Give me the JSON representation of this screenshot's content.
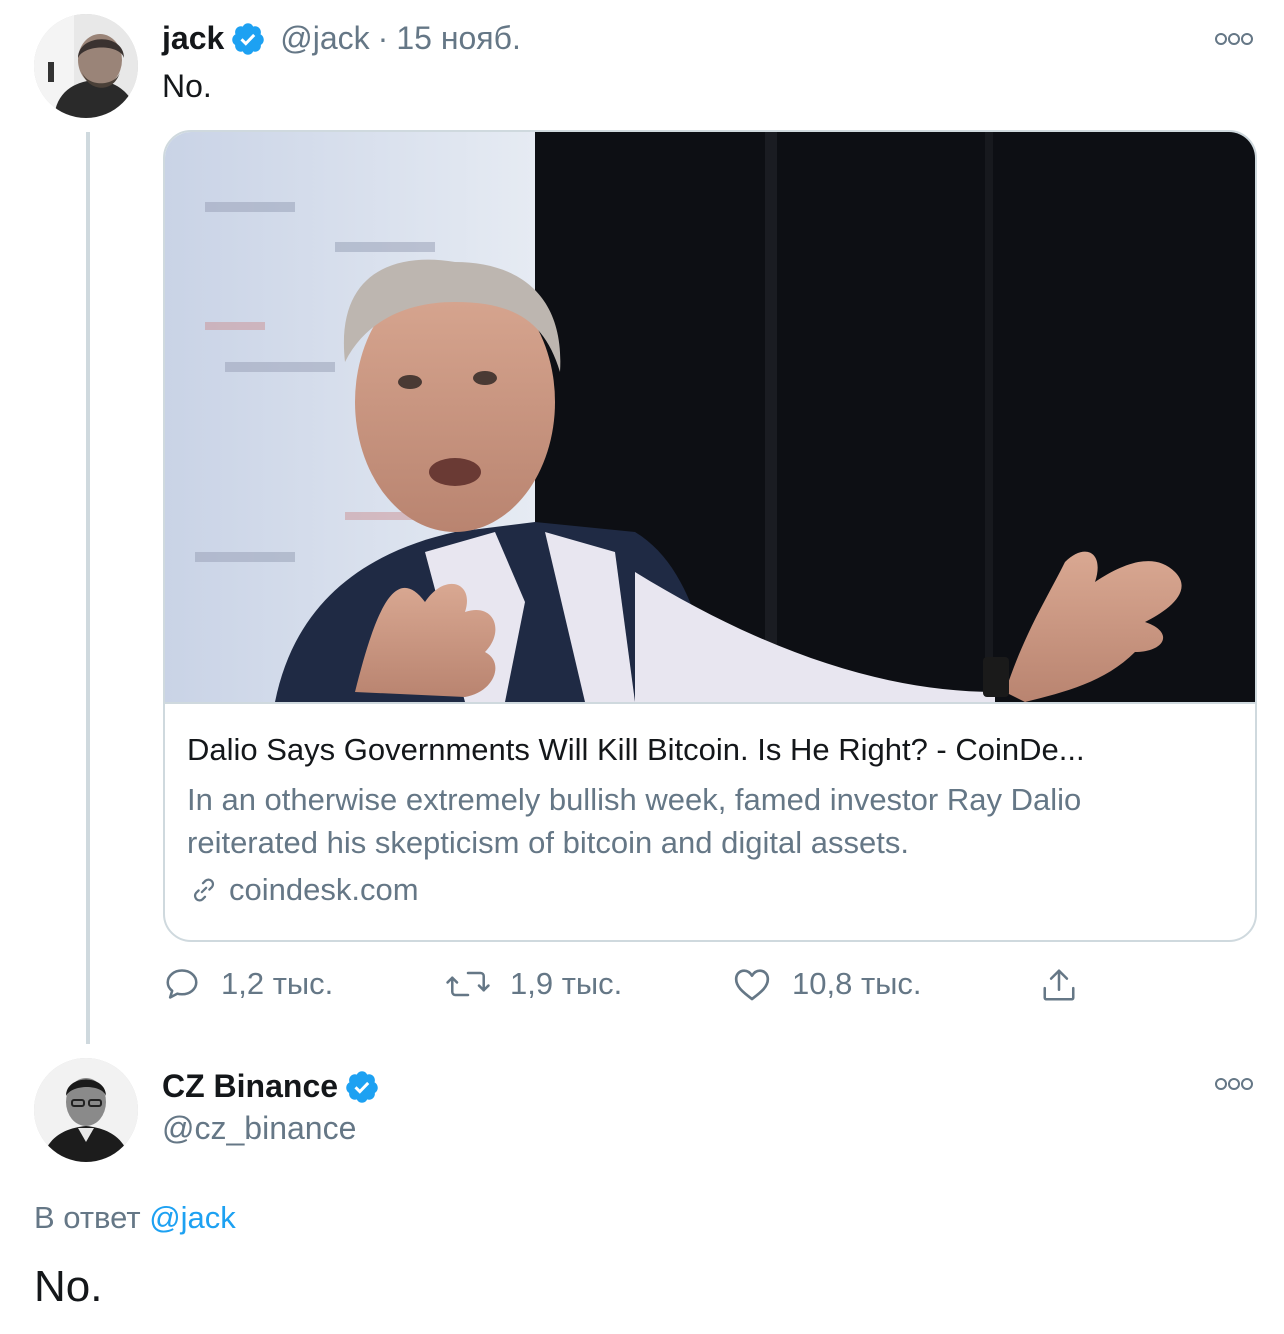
{
  "original_tweet": {
    "display_name": "jack",
    "handle": "@jack",
    "separator": "·",
    "date": "15 нояб.",
    "text": "No.",
    "verified": true,
    "avatar_icon": "profile-photo-jack",
    "card": {
      "title": "Dalio Says Governments Will Kill Bitcoin. Is He Right? - CoinDe...",
      "description": "In an otherwise extremely bullish week, famed investor Ray Dalio reiterated his skepticism of bitcoin and digital assets.",
      "domain": "coindesk.com",
      "link_icon": "link-icon"
    },
    "actions": {
      "replies": "1,2 тыс.",
      "retweets": "1,9 тыс.",
      "likes": "10,8 тыс.",
      "reply_icon": "speech-bubble-icon",
      "retweet_icon": "retweet-icon",
      "like_icon": "heart-icon",
      "share_icon": "share-icon"
    }
  },
  "reply_tweet": {
    "display_name": "CZ Binance",
    "handle": "@cz_binance",
    "verified": true,
    "avatar_icon": "profile-photo-cz",
    "reply_prefix": "В ответ",
    "reply_mention": "@jack",
    "text": "No."
  },
  "colors": {
    "verified_blue": "#1da1f2",
    "secondary_text": "#657786",
    "primary_text": "#14171a",
    "border": "#cfd9de"
  }
}
